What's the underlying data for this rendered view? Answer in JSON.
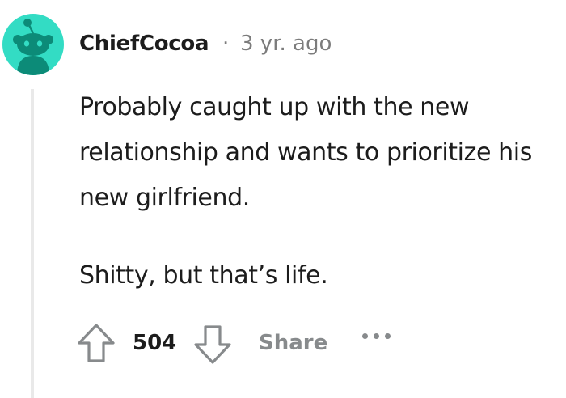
{
  "comment": {
    "username": "ChiefCocoa",
    "separator": "·",
    "timestamp": "3 yr. ago",
    "paragraphs": [
      "Probably caught up with the new relationship and wants to prioritize his new girlfriend.",
      "Shitty, but that’s life."
    ]
  },
  "actions": {
    "score": "504",
    "share_label": "Share"
  },
  "colors": {
    "avatar_bg": "#33dcc4",
    "avatar_figure": "#0c8b78",
    "text_primary": "#1c1c1c",
    "text_muted": "#7c7c7c",
    "thread_line": "#e9e9e9"
  },
  "icons": {
    "avatar": "reddit-snoo-avatar",
    "upvote": "upvote-arrow-icon",
    "downvote": "downvote-arrow-icon",
    "more": "more-options-icon"
  }
}
